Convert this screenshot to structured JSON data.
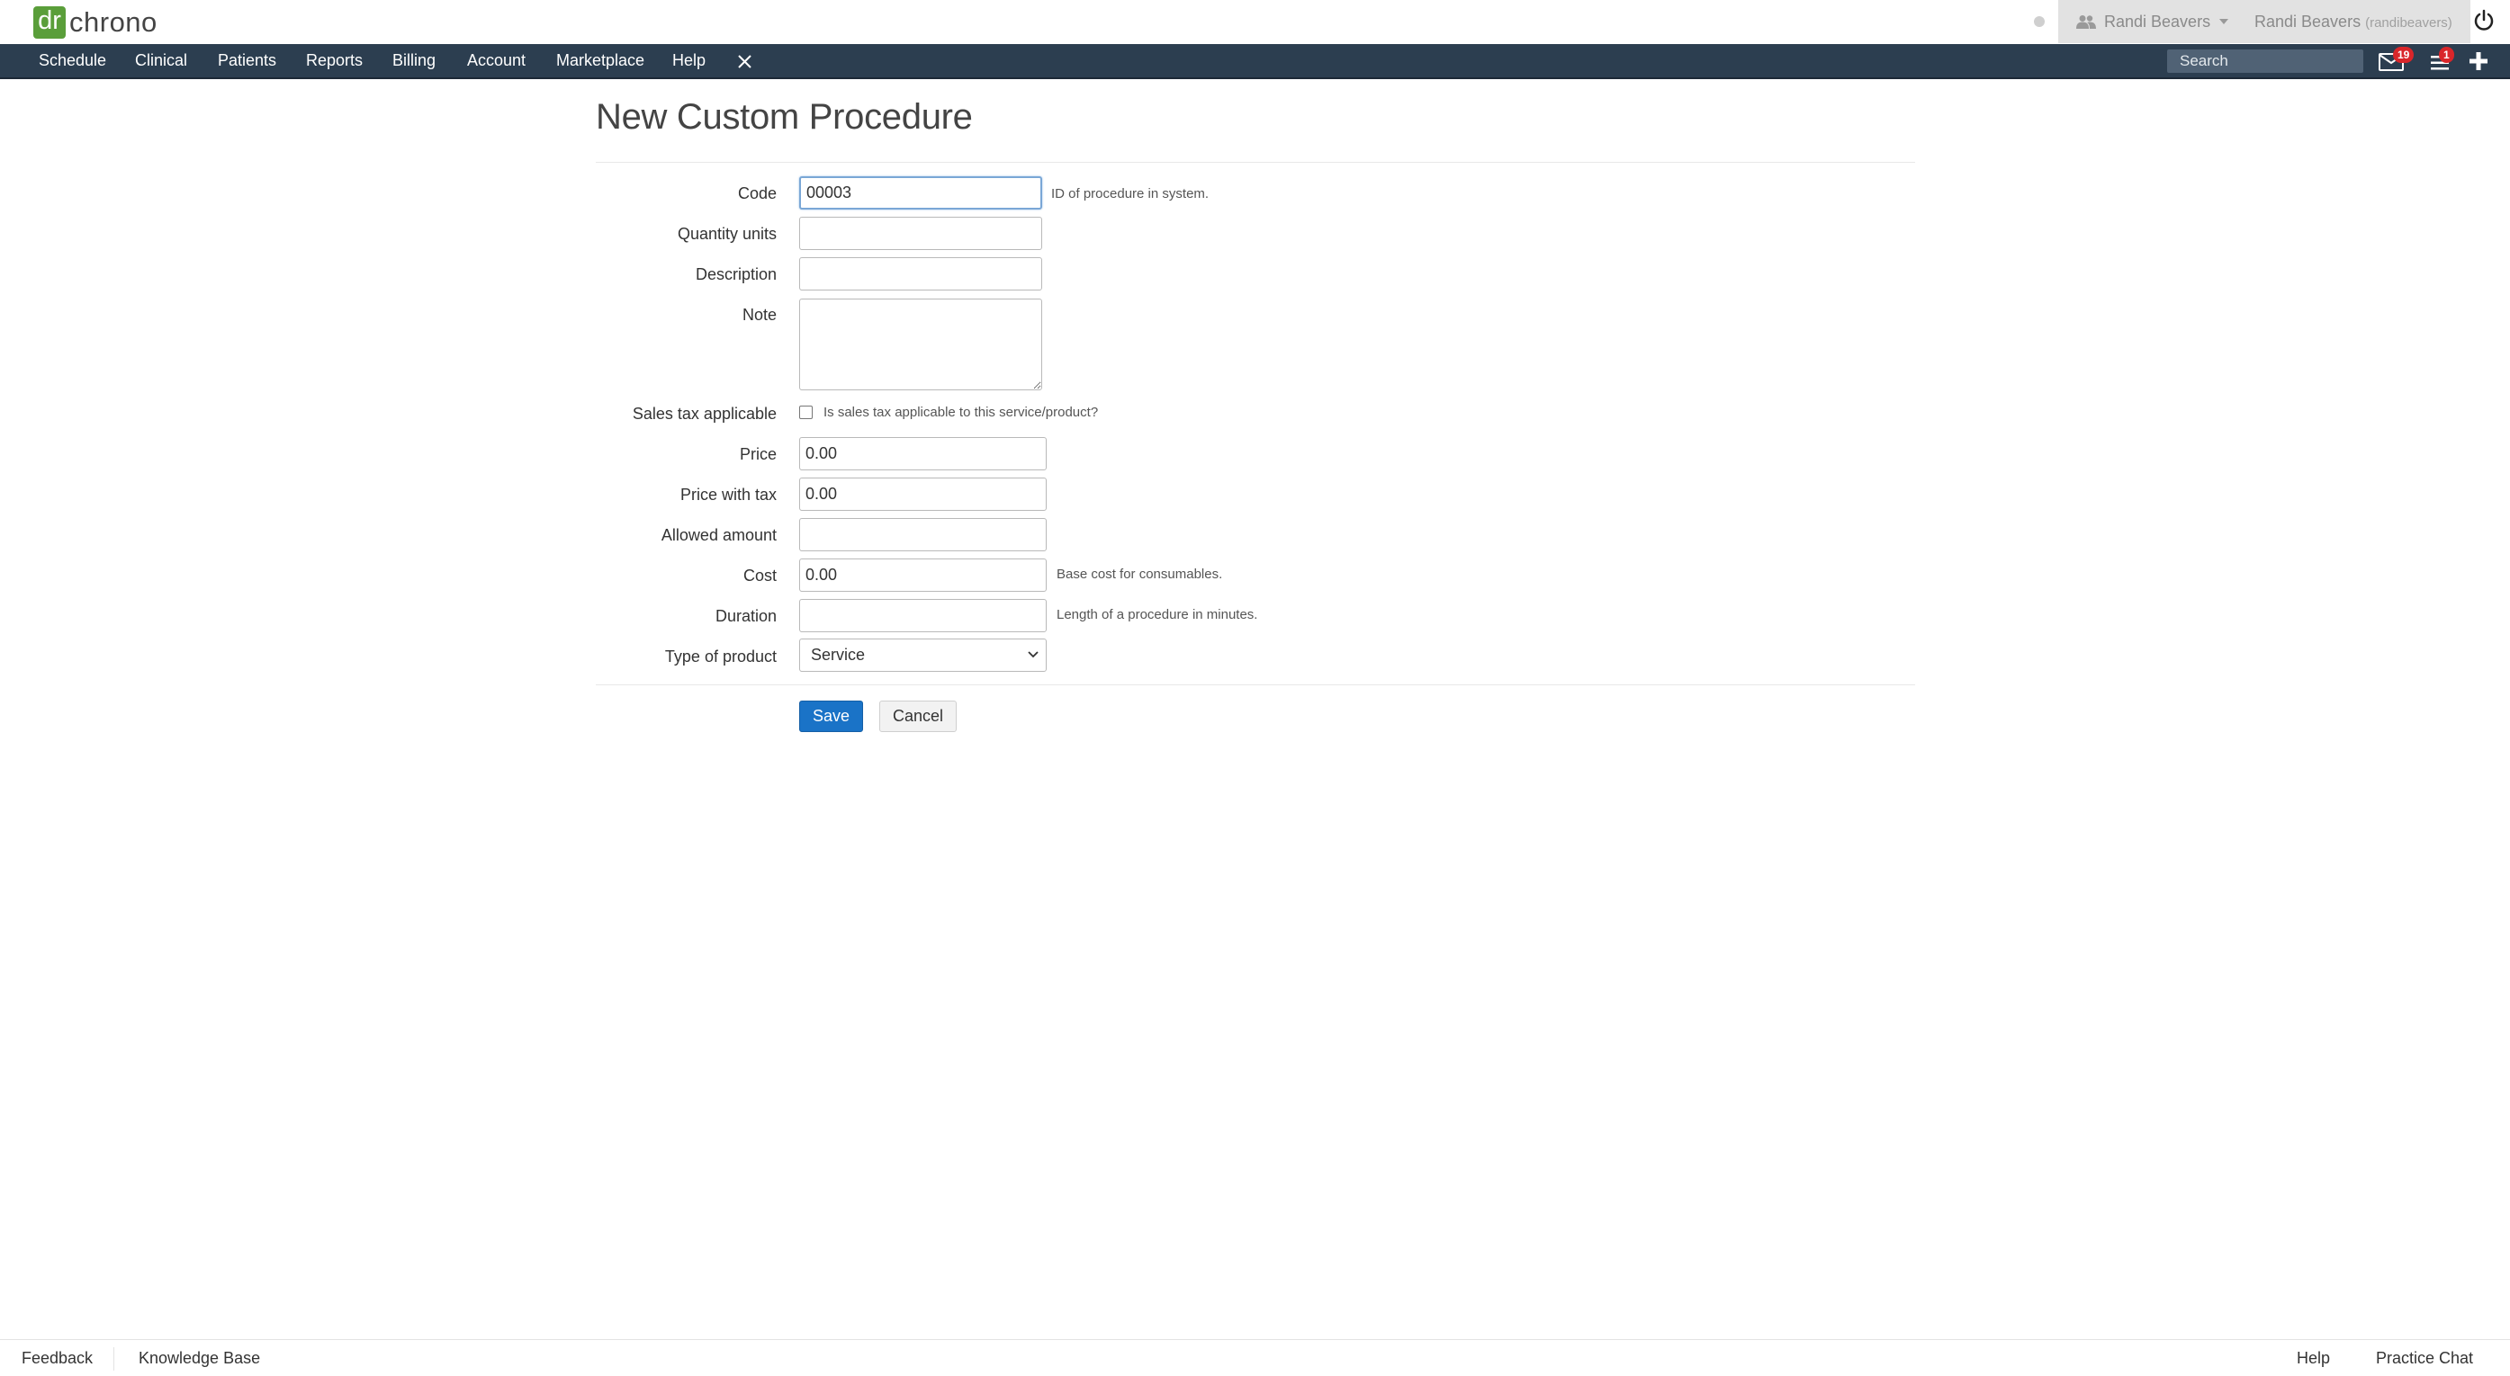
{
  "app": {
    "logo_mark": "dr",
    "logo_text": "chrono"
  },
  "user": {
    "switcher_name": "Randi Beavers",
    "current_name": "Randi Beavers",
    "current_username": "(randibeavers)"
  },
  "nav": {
    "items": [
      "Schedule",
      "Clinical",
      "Patients",
      "Reports",
      "Billing",
      "Account",
      "Marketplace",
      "Help"
    ],
    "search_placeholder": "Search",
    "messages_count": "19",
    "tasks_count": "1"
  },
  "page": {
    "title": "New Custom Procedure"
  },
  "form": {
    "code": {
      "label": "Code",
      "value": "00003",
      "help": "ID of procedure in system."
    },
    "quantity_units": {
      "label": "Quantity units",
      "value": ""
    },
    "description": {
      "label": "Description",
      "value": ""
    },
    "note": {
      "label": "Note",
      "value": ""
    },
    "sales_tax": {
      "label": "Sales tax applicable",
      "help": "Is sales tax applicable to this service/product?",
      "checked": false
    },
    "price": {
      "label": "Price",
      "value": "0.00"
    },
    "price_with_tax": {
      "label": "Price with tax",
      "value": "0.00"
    },
    "allowed_amount": {
      "label": "Allowed amount",
      "value": ""
    },
    "cost": {
      "label": "Cost",
      "value": "0.00",
      "help": "Base cost for consumables."
    },
    "duration": {
      "label": "Duration",
      "value": "",
      "help": "Length of a procedure in minutes."
    },
    "type_of_product": {
      "label": "Type of product",
      "selected": "Service"
    },
    "save_label": "Save",
    "cancel_label": "Cancel"
  },
  "footer": {
    "feedback": "Feedback",
    "knowledge_base": "Knowledge Base",
    "help": "Help",
    "practice_chat": "Practice Chat"
  },
  "colors": {
    "nav_bg": "#2c3e50",
    "logo_green": "#5a9e3a",
    "primary_button": "#1a73c7",
    "badge_red": "#d9262a"
  }
}
